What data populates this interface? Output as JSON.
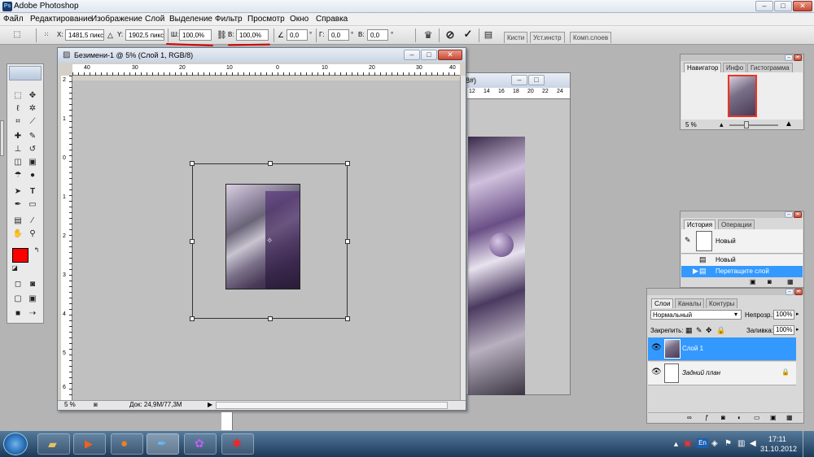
{
  "app": {
    "title": "Adobe Photoshop"
  },
  "window_controls": {
    "min": "–",
    "max": "□",
    "close": "✕"
  },
  "menu": [
    "Файл",
    "Редактирование",
    "Изображение",
    "Слой",
    "Выделение",
    "Фильтр",
    "Просмотр",
    "Окно",
    "Справка"
  ],
  "options": {
    "x_label": "X:",
    "x_value": "1481,5 пикс",
    "y_label": "Y:",
    "y_value": "1902,5 пикс",
    "w_label": "Ш:",
    "w_value": "100,0%",
    "h_label": "В:",
    "h_value": "100,0%",
    "angle_value": "0,0",
    "angle_unit": "°",
    "hskew_label": "Г:",
    "hskew_value": "0,0",
    "vskew_label": "В:",
    "vskew_value": "0,0",
    "tabs": [
      "Кисти",
      "Уст.инстр",
      "Комп.слоев"
    ]
  },
  "document": {
    "title": "Безимени-1 @ 5% (Слой 1, RGB/8)",
    "zoom": "5 %",
    "doc_size": "Док: 24,9M/77,3M",
    "ruler_top": [
      "40",
      "30",
      "20",
      "10",
      "0",
      "10",
      "20",
      "30",
      "40"
    ],
    "ruler_left": [
      "2",
      "1",
      "0",
      "1",
      "2",
      "3",
      "4",
      "5",
      "6"
    ]
  },
  "back_document": {
    "title_fragment": "8#)",
    "ruler": [
      "12",
      "14",
      "16",
      "18",
      "20",
      "22",
      "24"
    ]
  },
  "navigator": {
    "tabs": [
      "Навигатор",
      "Инфо",
      "Гистограмма"
    ],
    "zoom": "5 %"
  },
  "history": {
    "tabs": [
      "История",
      "Операции"
    ],
    "snapshot": "Новый",
    "items": [
      "Новый",
      "Перетащите слой"
    ]
  },
  "layers": {
    "tabs": [
      "Слои",
      "Каналы",
      "Контуры"
    ],
    "blend_mode": "Нормальный",
    "opacity_label": "Непрозр.:",
    "opacity_value": "100%",
    "lock_label": "Закрепить:",
    "fill_label": "Заливка:",
    "fill_value": "100%",
    "items": [
      {
        "name": "Слой 1",
        "selected": true
      },
      {
        "name": "Задний план",
        "selected": false
      }
    ]
  },
  "taskbar": {
    "lang": "En",
    "time": "17:11",
    "date": "31.10.2012"
  },
  "colors": {
    "foreground": "#ff0000",
    "background": "#ffffff",
    "selection": "#3399ff",
    "annotation": "#d10000"
  }
}
